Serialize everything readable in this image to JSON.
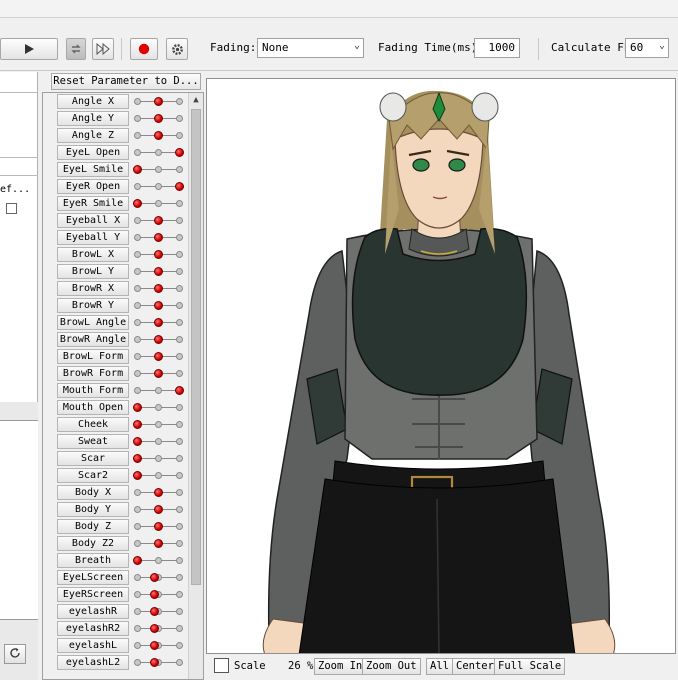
{
  "toolbar": {
    "play_icon": "play-icon",
    "loop_icon": "loop-icon",
    "step_icon": "fast-forward-icon",
    "record_icon": "record-icon",
    "settings_icon": "gear-icon",
    "fading_label": "Fading:",
    "fading_value": "None",
    "fading_time_label": "Fading Time(ms):",
    "fading_time_value": "1000",
    "fps_label": "Calculate FPS",
    "fps_value": "60"
  },
  "left_panel": {
    "ref_text": "ef..."
  },
  "params": {
    "reset_label": "Reset Parameter to D...",
    "items": [
      {
        "label": "Angle X",
        "value": 0.5
      },
      {
        "label": "Angle Y",
        "value": 0.5
      },
      {
        "label": "Angle Z",
        "value": 0.5
      },
      {
        "label": "EyeL Open",
        "value": 1.0
      },
      {
        "label": "EyeL Smile",
        "value": 0.0
      },
      {
        "label": "EyeR Open",
        "value": 1.0
      },
      {
        "label": "EyeR Smile",
        "value": 0.0
      },
      {
        "label": "Eyeball X",
        "value": 0.5
      },
      {
        "label": "Eyeball Y",
        "value": 0.5
      },
      {
        "label": "BrowL X",
        "value": 0.5
      },
      {
        "label": "BrowL Y",
        "value": 0.5
      },
      {
        "label": "BrowR X",
        "value": 0.5
      },
      {
        "label": "BrowR Y",
        "value": 0.5
      },
      {
        "label": "BrowL Angle",
        "value": 0.5
      },
      {
        "label": "BrowR Angle",
        "value": 0.5
      },
      {
        "label": "BrowL Form",
        "value": 0.5
      },
      {
        "label": "BrowR Form",
        "value": 0.5
      },
      {
        "label": "Mouth Form",
        "value": 1.0
      },
      {
        "label": "Mouth Open",
        "value": 0.0
      },
      {
        "label": "Cheek",
        "value": 0.0
      },
      {
        "label": "Sweat",
        "value": 0.0
      },
      {
        "label": "Scar",
        "value": 0.0
      },
      {
        "label": "Scar2",
        "value": 0.0
      },
      {
        "label": "Body X",
        "value": 0.5
      },
      {
        "label": "Body Y",
        "value": 0.5
      },
      {
        "label": "Body Z",
        "value": 0.5
      },
      {
        "label": "Body Z2",
        "value": 0.5
      },
      {
        "label": "Breath",
        "value": 0.0
      },
      {
        "label": "EyeLScreen",
        "value": 0.4
      },
      {
        "label": "EyeRScreen",
        "value": 0.4
      },
      {
        "label": "eyelashR",
        "value": 0.4
      },
      {
        "label": "eyelashR2",
        "value": 0.4
      },
      {
        "label": "eyelashL",
        "value": 0.4
      },
      {
        "label": "eyelashL2",
        "value": 0.4
      }
    ]
  },
  "bottombar": {
    "scale_label": "Scale",
    "zoom_value": "26 %",
    "zoom_in": "Zoom In",
    "zoom_out": "Zoom Out",
    "all": "All",
    "center": "Center",
    "full_scale": "Full Scale"
  },
  "colors": {
    "knob": "#d00000",
    "hair": "#b59f6c",
    "vest": "#283530",
    "suit": "#6e706e",
    "pants": "#151515",
    "skin": "#f3d8bd",
    "gem": "#1f8a3a",
    "eyes": "#2f8a4a"
  }
}
